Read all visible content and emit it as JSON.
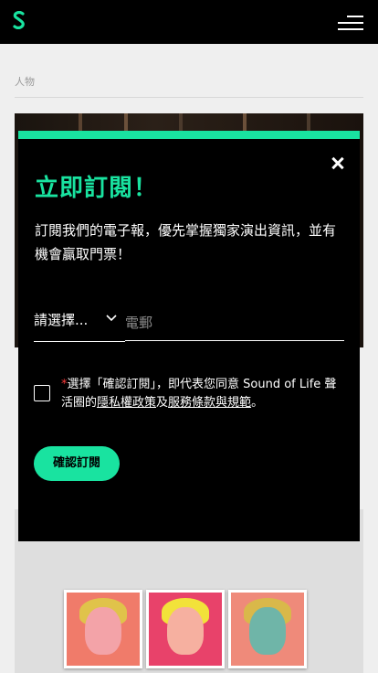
{
  "header": {
    "logo_icon": "s-logo-icon",
    "menu_icon": "hamburger-menu-icon",
    "accent_color": "#19e3a0"
  },
  "page": {
    "breadcrumb": "人物"
  },
  "modal": {
    "title": "立即訂閱！",
    "description": "訂閱我們的電子報，優先掌握獨家演出資訊，並有機會贏取門票！",
    "close_icon": "close-icon",
    "select": {
      "selected_label": "請選擇...",
      "chevron_icon": "chevron-down-icon"
    },
    "email": {
      "placeholder": "電郵"
    },
    "consent": {
      "required_mark": "*",
      "text_before": "選擇「確認訂閱」，即代表您同意 Sound of Life 聲活圈的",
      "privacy_link": "隱私權政策",
      "joiner": "及",
      "terms_link": "服務條款與規範",
      "text_after": "。"
    },
    "confirm_button": "確認訂閱"
  }
}
